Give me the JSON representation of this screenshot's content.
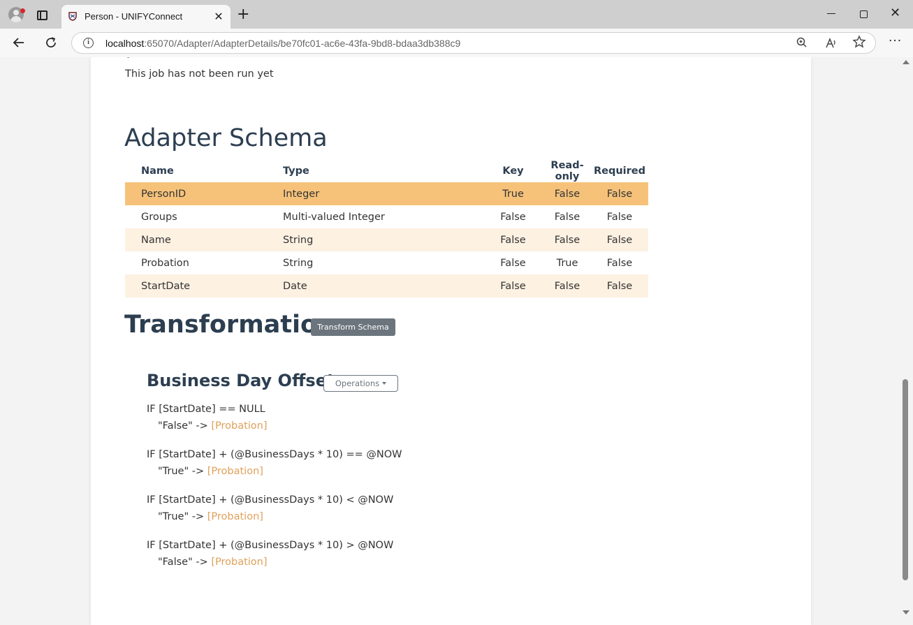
{
  "browser": {
    "tab_title": "Person - UNIFYConnect",
    "url_host": "localhost",
    "url_path": ":65070/Adapter/AdapterDetails/be70fc01-ac6e-43fa-9bd8-bdaa3db388c9",
    "new_tab_glyph": "+",
    "close_glyph": "✕",
    "menu_glyph": "···"
  },
  "page": {
    "job_status": "This job has not been run yet",
    "schema_title": "Adapter Schema",
    "schema_columns": {
      "name": "Name",
      "type": "Type",
      "key": "Key",
      "readonly": "Read-only",
      "required": "Required"
    },
    "schema_rows": [
      {
        "name": "PersonID",
        "type": "Integer",
        "key": "True",
        "readonly": "False",
        "required": "False"
      },
      {
        "name": "Groups",
        "type": "Multi-valued Integer",
        "key": "False",
        "readonly": "False",
        "required": "False"
      },
      {
        "name": "Name",
        "type": "String",
        "key": "False",
        "readonly": "False",
        "required": "False"
      },
      {
        "name": "Probation",
        "type": "String",
        "key": "False",
        "readonly": "True",
        "required": "False"
      },
      {
        "name": "StartDate",
        "type": "Date",
        "key": "False",
        "readonly": "False",
        "required": "False"
      }
    ],
    "transformations_title": "Transformations",
    "transform_button": "Transform Schema",
    "transformation": {
      "title": "Business Day Offset",
      "operations_button": "Operations",
      "rules": [
        {
          "condition": "IF [StartDate] == NULL",
          "value": "\"False\" -> ",
          "target": "[Probation]"
        },
        {
          "condition": "IF [StartDate] + (@BusinessDays * 10) == @NOW",
          "value": "\"True\" -> ",
          "target": "[Probation]"
        },
        {
          "condition": "IF [StartDate] + (@BusinessDays * 10) < @NOW",
          "value": "\"True\" -> ",
          "target": "[Probation]"
        },
        {
          "condition": "IF [StartDate] + (@BusinessDays * 10) > @NOW",
          "value": "\"False\" -> ",
          "target": "[Probation]"
        }
      ]
    }
  },
  "colors": {
    "selected_row": "#f6c27a",
    "alt_row": "#fdf1e2",
    "target_text": "#e0a15a",
    "secondary_button": "#6c757d",
    "heading": "#2c3e50"
  },
  "icons": [
    "profile-icon",
    "tab-actions-icon",
    "site-favicon",
    "back-arrow-icon",
    "reload-icon",
    "info-icon",
    "zoom-icon",
    "read-aloud-icon",
    "favorites-star-icon",
    "more-menu-icon"
  ]
}
